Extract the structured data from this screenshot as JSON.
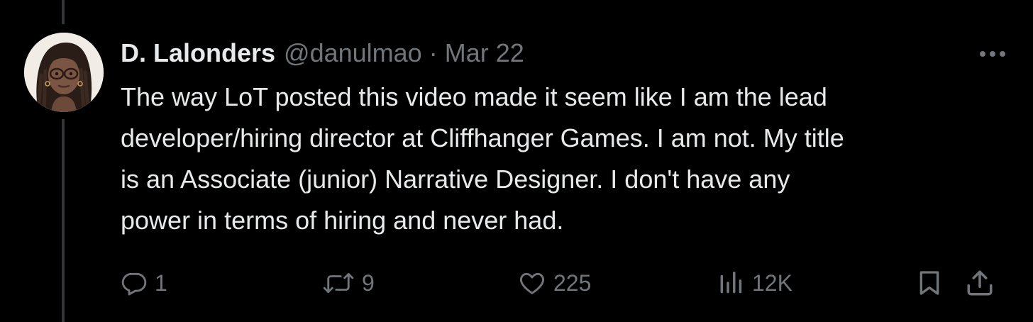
{
  "tweet": {
    "author": {
      "display_name": "D. Lalonders",
      "handle": "@danulmao",
      "avatar_icon": "avatar-illustration"
    },
    "separator": "·",
    "date": "Mar 22",
    "lines": [
      "The way LoT posted this video made it seem like I am the lead",
      "developer/hiring director at Cliffhanger Games. I am not. My title",
      "is an Associate (junior) Narrative Designer. I don't have any",
      "power in terms of hiring and never had."
    ],
    "more_icon": "more-icon",
    "actions": {
      "reply": {
        "icon": "reply-icon",
        "count": "1"
      },
      "retweet": {
        "icon": "retweet-icon",
        "count": "9"
      },
      "like": {
        "icon": "heart-icon",
        "count": "225"
      },
      "views": {
        "icon": "views-icon",
        "count": "12K"
      },
      "bookmark": {
        "icon": "bookmark-icon"
      },
      "share": {
        "icon": "share-icon"
      }
    }
  },
  "colors": {
    "background": "#000000",
    "primary_text": "#e7e9ea",
    "secondary_text": "#71767b",
    "thread_line": "#333639"
  }
}
